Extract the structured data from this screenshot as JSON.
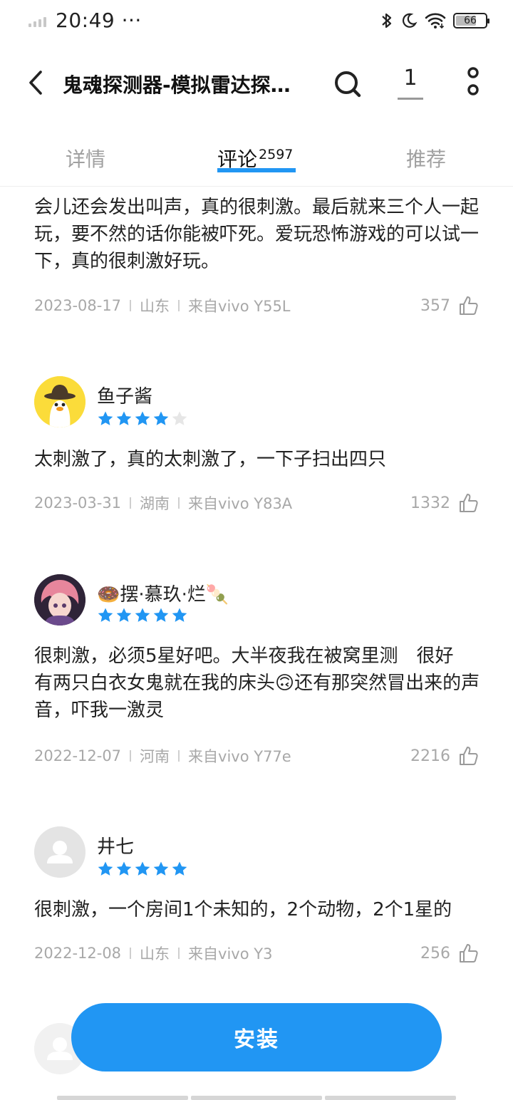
{
  "status_bar": {
    "time": "20:49",
    "dots": "···",
    "battery": "66"
  },
  "header": {
    "title": "鬼魂探测器-模拟雷达探…",
    "count": "1"
  },
  "tabs": {
    "details": "详情",
    "comments": "评论",
    "comments_count": "2597",
    "recommend": "推荐"
  },
  "reviews": [
    {
      "text": "会儿还会发出叫声，真的很刺激。最后就来三个人一起玩，要不然的话你能被吓死。爱玩恐怖游戏的可以试一下，真的很刺激好玩。",
      "date": "2023-08-17",
      "region": "山东",
      "device": "来自vivo Y55L",
      "likes": "357"
    },
    {
      "user": "鱼子酱",
      "stars": 4,
      "text": "太刺激了，真的太刺激了，一下子扫出四只",
      "date": "2023-03-31",
      "region": "湖南",
      "device": "来自vivo Y83A",
      "likes": "1332"
    },
    {
      "user": "🍩摆·慕玖·烂🍡",
      "stars": 5,
      "text": "很刺激，必须5星好吧。大半夜我在被窝里测　很好　有两只白衣女鬼就在我的床头🙃还有那突然冒出来的声音，吓我一激灵",
      "date": "2022-12-07",
      "region": "河南",
      "device": "来自vivo Y77e",
      "likes": "2216"
    },
    {
      "user": "井七",
      "stars": 5,
      "text": "很刺激，一个房间1个未知的，2个动物，2个1星的",
      "date": "2022-12-08",
      "region": "山东",
      "device": "来自vivo Y3",
      "likes": "256"
    }
  ],
  "install": {
    "label": "安装"
  },
  "colors": {
    "accent": "#2196f3",
    "star_empty": "#e6e6e6",
    "meta_text": "#a8a8a8"
  }
}
